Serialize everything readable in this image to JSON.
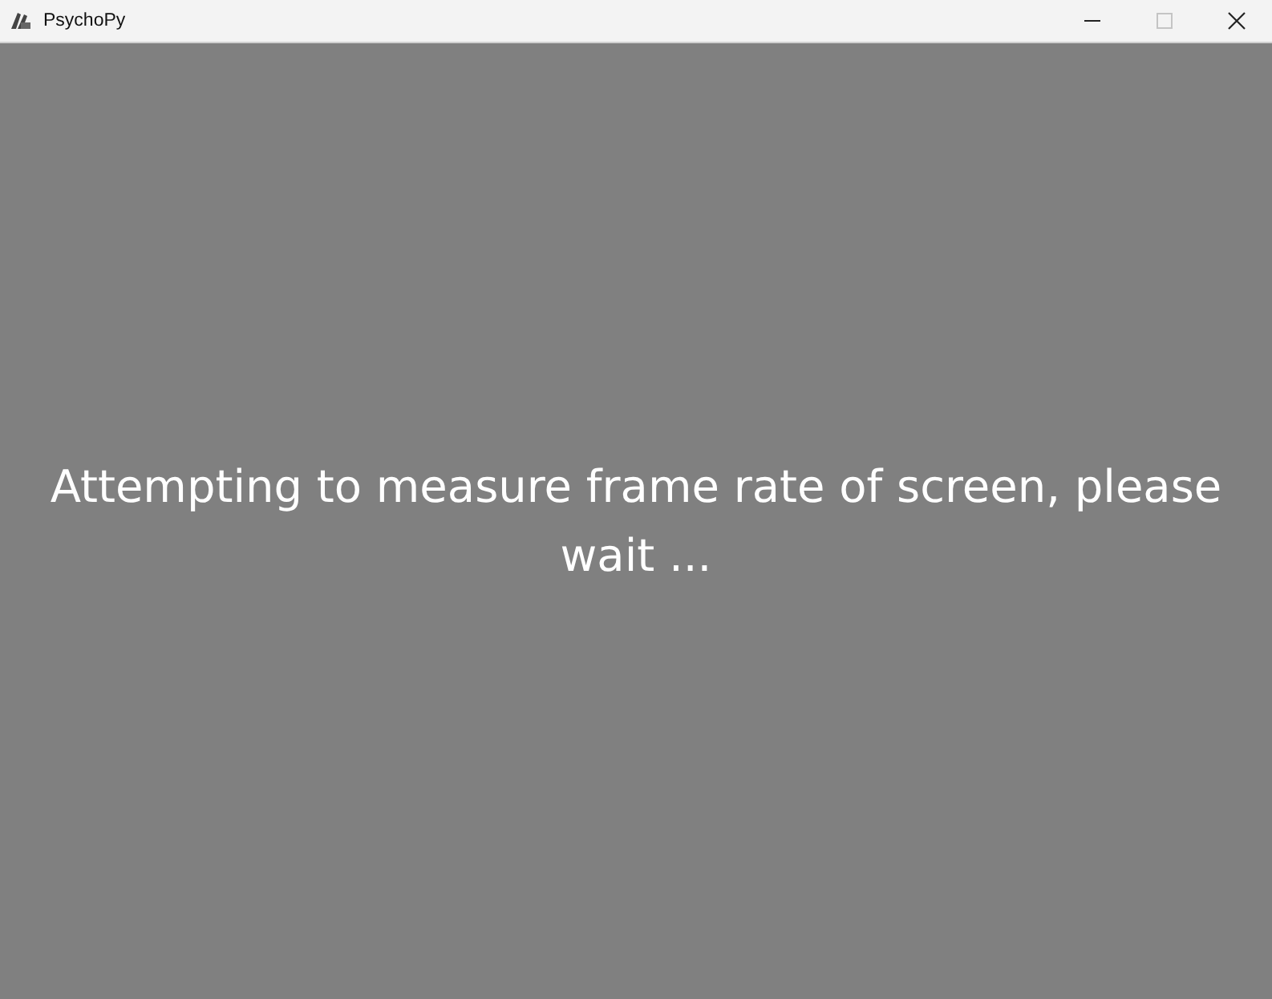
{
  "window": {
    "title": "PsychoPy",
    "controls": [
      {
        "kind": "minimize",
        "disabled": false
      },
      {
        "kind": "maximize",
        "disabled": true
      },
      {
        "kind": "close",
        "disabled": false
      }
    ]
  },
  "message": "Attempting to measure frame rate of screen, please wait ..."
}
